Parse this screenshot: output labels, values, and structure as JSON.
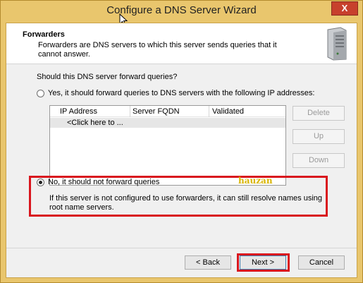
{
  "window": {
    "title": "Configure a DNS Server Wizard",
    "close_glyph": "X"
  },
  "header": {
    "title": "Forwarders",
    "description": "Forwarders are DNS servers to which this server sends queries that it cannot answer.",
    "icon": "server-icon"
  },
  "question": "Should this DNS server forward queries?",
  "option_yes": {
    "label": "Yes, it should forward queries to DNS servers with the following IP addresses:",
    "selected": false
  },
  "ip_table": {
    "columns": [
      "IP Address",
      "Server FQDN",
      "Validated"
    ],
    "placeholder_row": "<Click here to ..."
  },
  "side_buttons": {
    "delete": "Delete",
    "up": "Up",
    "down": "Down"
  },
  "option_no": {
    "label": "No, it should not forward queries",
    "selected": true,
    "description": "If this server is not configured to use forwarders, it can still resolve names using root name servers."
  },
  "watermark": "hauzan",
  "footer": {
    "back": "< Back",
    "next": "Next >",
    "cancel": "Cancel"
  },
  "colors": {
    "title_bar": "#e9c66d",
    "highlight_box": "#d9161e",
    "close_button": "#c7402d"
  }
}
